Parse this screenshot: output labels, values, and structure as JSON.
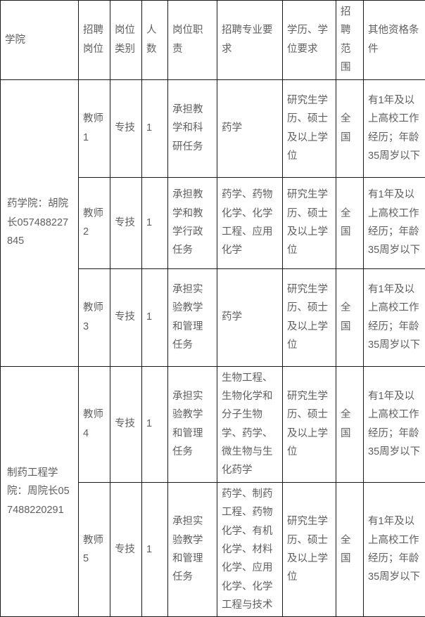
{
  "table": {
    "headers": [
      "学院",
      "招聘岗位",
      "岗位类别",
      "人数",
      "岗位职责",
      "招聘专业要求",
      "学历、学位要求",
      "招聘范围",
      "其他资格条件"
    ],
    "colleges": [
      {
        "name": "药学院：胡院长057488227845",
        "rowspan": 3
      },
      {
        "name": "制药工程学院：周院长057488220291",
        "rowspan": 2
      }
    ],
    "rows": [
      {
        "post": "教师1",
        "category": "专技",
        "headcount": "1",
        "duty": "承担教学和科研任务",
        "major": "药学",
        "degree": "研究生学历、硕士及以上学位",
        "scope": "全国",
        "other": "有1年及以上高校工作经历；年龄35周岁以下"
      },
      {
        "post": "教师2",
        "category": "专技",
        "headcount": "1",
        "duty": "承担教学和教学行政任务",
        "major": "药学、药物化学、化学工程、应用化学",
        "degree": "研究生学历、硕士及以上学位",
        "scope": "全国",
        "other": "有1年及以上高校工作经历；年龄35周岁以下"
      },
      {
        "post": "教师3",
        "category": "专技",
        "headcount": "1",
        "duty": "承担实验教学和管理任务",
        "major": "药学",
        "degree": "研究生学历、硕士及以上学位",
        "scope": "全国",
        "other": "有1年及以上高校工作经历；年龄35周岁以下"
      },
      {
        "post": "教师4",
        "category": "专技",
        "headcount": "1",
        "duty": "承担实验教学和管理任务",
        "major": "生物工程、生物化学和分子生物学、药学、微生物与生化药学",
        "degree": "研究生学历、硕士及以上学位",
        "scope": "全国",
        "other": "有1年及以上高校工作经历；年龄35周岁以下"
      },
      {
        "post": "教师5",
        "category": "专技",
        "headcount": "1",
        "duty": "承担实验教学和管理任务",
        "major": "药学、制药工程、药物化学、有机化学、材料化学、应用化学、化学工程与技术",
        "degree": "研究生学历、硕士及以上学位",
        "scope": "全国",
        "other": "有1年及以上高校工作经历；年龄35周岁以下"
      }
    ]
  },
  "style": {
    "border_color": "#1a1a1a",
    "text_color": "#5f5f5f",
    "background": "#ffffff"
  }
}
